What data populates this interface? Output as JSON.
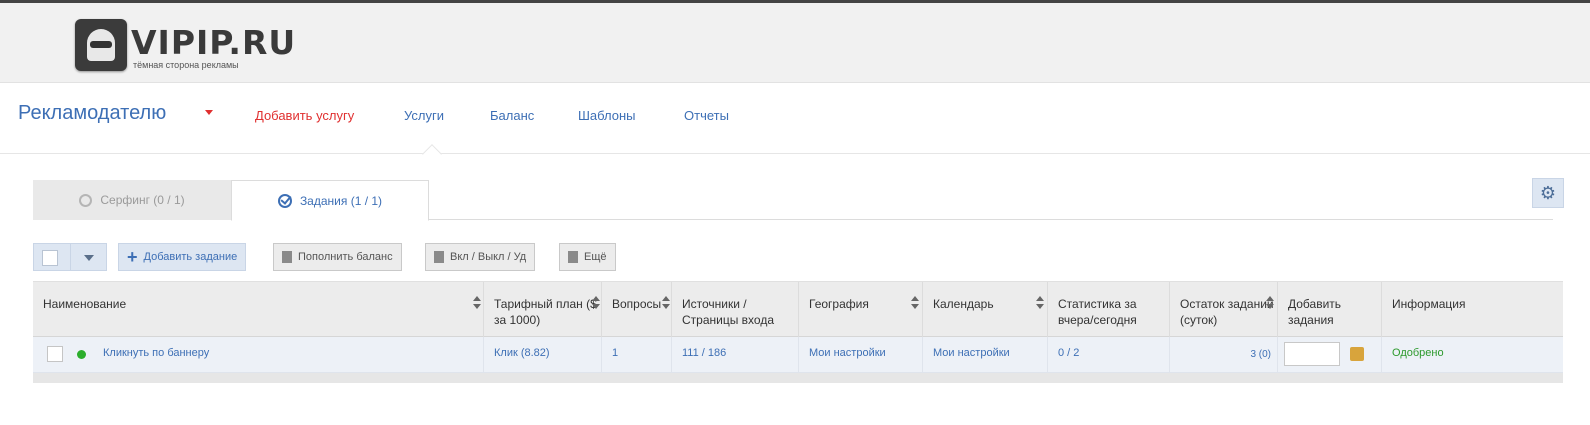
{
  "logo": {
    "text": "VIPIP.RU",
    "tagline": "тёмная сторона рекламы"
  },
  "nav": {
    "brand": "Рекламодателю",
    "items": [
      "Добавить услугу",
      "Услуги",
      "Баланс",
      "Шаблоны",
      "Отчеты"
    ]
  },
  "tabs": [
    {
      "label": "Серфинг (0 / 1)",
      "icon": "circle-icon",
      "active": false
    },
    {
      "label": "Задания (1 / 1)",
      "icon": "check-circle-icon",
      "active": true
    }
  ],
  "toolbar": {
    "add_task": "Добавить задание",
    "top_up": "Пополнить баланс",
    "on_off_del": "Вкл / Выкл / Уд",
    "more": "Ещё"
  },
  "table": {
    "headers": [
      "Наименование",
      "Тарифный план ($ за 1000)",
      "Вопросы",
      "Источники / Страницы входа",
      "География",
      "Календарь",
      "Статистика за вчера/сегодня",
      "Остаток заданий (суток)",
      "Добавить задания",
      "Информация"
    ],
    "rows": [
      {
        "name": "Кликнуть по баннеру",
        "plan": "Клик (8.82)",
        "questions": "1",
        "sources": "111 / 186",
        "geo": "Мои настройки",
        "calendar": "Мои настройки",
        "stats": "0 / 2",
        "remaining": "3 (0)",
        "add": "",
        "info": "Одобрено"
      }
    ]
  },
  "colors": {
    "accent": "#3d6fb5",
    "red": "#e03030",
    "success": "#2d9a2d"
  }
}
